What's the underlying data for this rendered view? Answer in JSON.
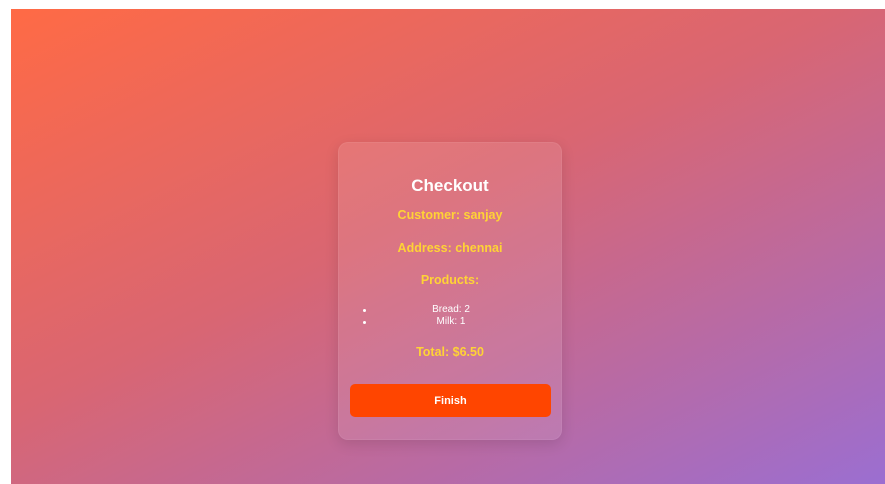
{
  "colors": {
    "gradient_start": "#ff6a45",
    "gradient_mid": "#d96672",
    "gradient_end": "#9b6ed1",
    "card_bg": "rgba(255,255,255,0.10)",
    "accent_text": "#ffd335",
    "title_text": "#ffffff",
    "button_bg": "#ff4500",
    "button_text": "#ffffff"
  },
  "checkout": {
    "title": "Checkout",
    "customer": "Customer: sanjay",
    "address": "Address: chennai",
    "products_heading": "Products:",
    "products": [
      {
        "label": "Bread: 2"
      },
      {
        "label": "Milk: 1"
      }
    ],
    "total": "Total: $6.50",
    "finish_label": "Finish"
  }
}
